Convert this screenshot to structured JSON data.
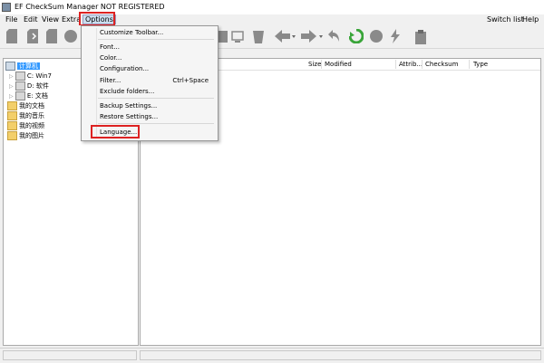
{
  "window": {
    "title": "EF CheckSum Manager NOT REGISTERED"
  },
  "menubar": {
    "items": [
      "File",
      "Edit",
      "View",
      "Extra",
      "Options"
    ],
    "right_items": [
      "Switch list",
      "Help"
    ]
  },
  "options_menu": {
    "items": [
      {
        "label": "Customize Toolbar..."
      },
      {
        "label": "Font..."
      },
      {
        "label": "Color..."
      },
      {
        "label": "Configuration..."
      },
      {
        "label": "Filter...",
        "shortcut": "Ctrl+Space"
      },
      {
        "label": "Exclude folders..."
      },
      {
        "label": "Backup Settings..."
      },
      {
        "label": "Restore Settings..."
      },
      {
        "label": "Language..."
      }
    ]
  },
  "tree": {
    "root": "计算机",
    "drives": [
      "C: Win7",
      "D: 软件",
      "E: 文档"
    ],
    "folders": [
      "我的文档",
      "我的音乐",
      "我的视频",
      "我的图片"
    ]
  },
  "columns": [
    "Size",
    "Modified",
    "Attrib...",
    "Checksum",
    "Type"
  ],
  "colors": {
    "highlight": "#dd2222",
    "selection": "#3399ff",
    "accent_green": "#3aa53a"
  },
  "toolbar_icons": [
    "new-icon",
    "open-icon",
    "save-icon",
    "circle-icon",
    "check-icon",
    "window-icon",
    "delete-icon",
    "back-icon",
    "forward-icon",
    "undo-icon",
    "refresh-icon",
    "stop-icon",
    "lightning-icon",
    "clipboard-icon"
  ]
}
